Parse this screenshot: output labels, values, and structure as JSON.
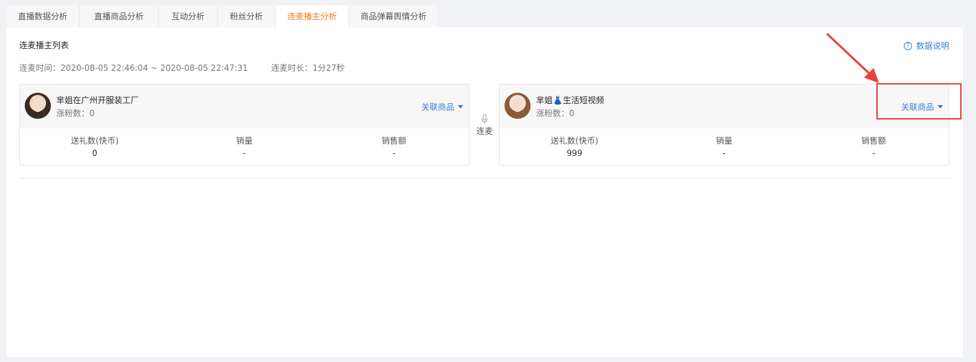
{
  "tabs": [
    {
      "label": "直播数据分析",
      "active": false
    },
    {
      "label": "直播商品分析",
      "active": false
    },
    {
      "label": "互动分析",
      "active": false
    },
    {
      "label": "粉丝分析",
      "active": false
    },
    {
      "label": "连麦播主分析",
      "active": true
    },
    {
      "label": "商品弹幕舆情分析",
      "active": false
    }
  ],
  "panel": {
    "title": "连麦播主列表",
    "help_label": "数据说明",
    "help_icon": "question-circle-icon",
    "time_text": "连麦时间：2020-08-05 22:46:04 ~ 2020-08-05 22:47:31",
    "duration_text": "连麦时长：1分27秒"
  },
  "lianmai_label": "连麦",
  "lianmai_icon": "microphone-icon",
  "anchors": [
    {
      "name": "芈姐在广州开服装工厂",
      "fans_text": "涨粉数：0",
      "assoc_label": "关联商品",
      "stats": [
        {
          "label": "送礼数(快币)",
          "value": "0"
        },
        {
          "label": "销量",
          "value": "-"
        },
        {
          "label": "销售额",
          "value": "-"
        }
      ]
    },
    {
      "name_prefix": "芈姐",
      "name_emoji": "👗",
      "name_suffix": "生活短视频",
      "fans_text": "涨粉数：0",
      "assoc_label": "关联商品",
      "stats": [
        {
          "label": "送礼数(快币)",
          "value": "999"
        },
        {
          "label": "销量",
          "value": "-"
        },
        {
          "label": "销售额",
          "value": "-"
        }
      ]
    }
  ],
  "colors": {
    "accent_active_tab": "#f27c1f",
    "link_blue": "#3b7cd8",
    "annotation_red": "#e8413a"
  }
}
